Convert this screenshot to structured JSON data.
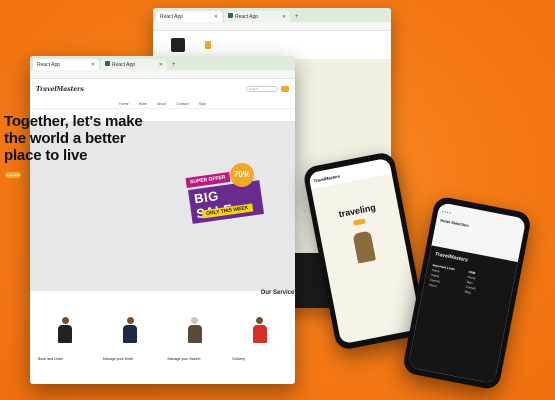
{
  "back_window": {
    "tabs": [
      {
        "label": "React App",
        "active": true
      },
      {
        "label": "React App",
        "active": false
      }
    ]
  },
  "front_window": {
    "tabs": [
      {
        "label": "React App",
        "active": true
      },
      {
        "label": "React App",
        "active": false
      }
    ],
    "logo": "TravelMasters",
    "search_placeholder": "Search",
    "nav": [
      "Home",
      "Hotel",
      "About",
      "Contact",
      "Sign"
    ],
    "hero": {
      "title": "Together, let's make the world a better place to live",
      "button": "Book Now"
    },
    "sale": {
      "super_offer": "SUPER OFFER",
      "big_sale": "BIG SALE",
      "only": "ONLY THIS WEEK",
      "percent": "70%"
    },
    "services": {
      "title": "Our Service",
      "cards": [
        {
          "label": "Book and Order"
        },
        {
          "label": "Manage your Hotel"
        },
        {
          "label": "Manage your Market"
        },
        {
          "label": "Delivery"
        }
      ]
    }
  },
  "phone_left": {
    "logo": "TravelMasters",
    "title": "traveling"
  },
  "phone_right": {
    "title": "Hotel Selection",
    "logo": "TravelMasters",
    "col1_head": "Important Links",
    "col2_head": "CRM",
    "col1": [
      "Home",
      "Hotels",
      "Contact",
      "About"
    ],
    "col2": [
      "Home",
      "Sign",
      "Contact",
      "Blog"
    ]
  },
  "colors": {
    "background": "#f47a16",
    "accent": "#f2a72a",
    "sale_purple": "#6b2a8e",
    "sale_pink": "#b81b86",
    "sale_yellow": "#f6d11a"
  }
}
